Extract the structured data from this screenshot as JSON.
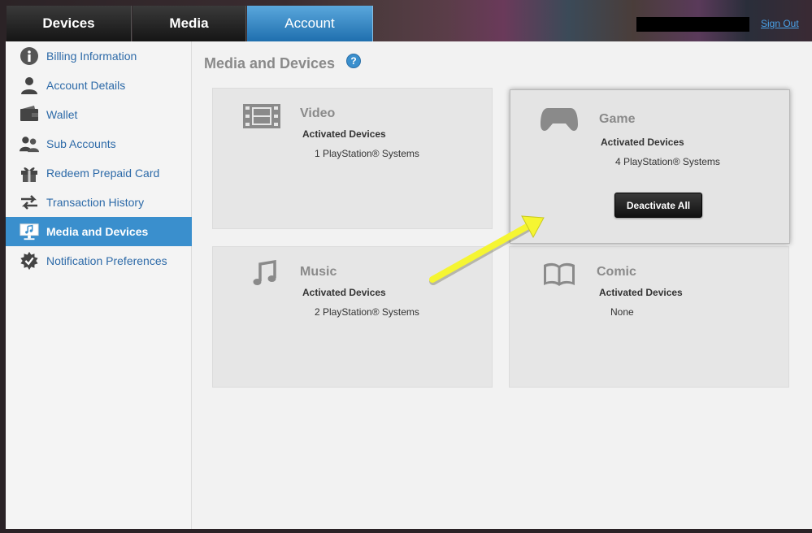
{
  "nav": {
    "tabs": [
      {
        "label": "Devices"
      },
      {
        "label": "Media"
      },
      {
        "label": "Account"
      }
    ],
    "active_tab": "Account",
    "sign_out": "Sign Out"
  },
  "sidebar": {
    "items": [
      {
        "label": "Billing Information",
        "icon": "info-icon"
      },
      {
        "label": "Account Details",
        "icon": "person-icon"
      },
      {
        "label": "Wallet",
        "icon": "wallet-icon"
      },
      {
        "label": "Sub Accounts",
        "icon": "people-icon"
      },
      {
        "label": "Redeem Prepaid Card",
        "icon": "gift-icon"
      },
      {
        "label": "Transaction History",
        "icon": "transfer-arrows-icon"
      },
      {
        "label": "Media and Devices",
        "icon": "media-devices-icon"
      },
      {
        "label": "Notification Preferences",
        "icon": "notification-badge-icon"
      }
    ],
    "active_index": 6
  },
  "main": {
    "title": "Media and Devices",
    "help": "?",
    "cards": [
      {
        "title": "Video",
        "subtitle": "Activated Devices",
        "value": "1 PlayStation® Systems",
        "icon": "film-icon"
      },
      {
        "title": "Game",
        "subtitle": "Activated Devices",
        "value": "4 PlayStation® Systems",
        "icon": "gamepad-icon",
        "button": "Deactivate All"
      },
      {
        "title": "Music",
        "subtitle": "Activated Devices",
        "value": "2 PlayStation® Systems",
        "icon": "music-note-icon"
      },
      {
        "title": "Comic",
        "subtitle": "Activated Devices",
        "value": "None",
        "icon": "book-icon"
      }
    ]
  },
  "colors": {
    "accent": "#3a8fcd",
    "link": "#2d6aa8",
    "annotation_arrow": "#f5f532"
  }
}
